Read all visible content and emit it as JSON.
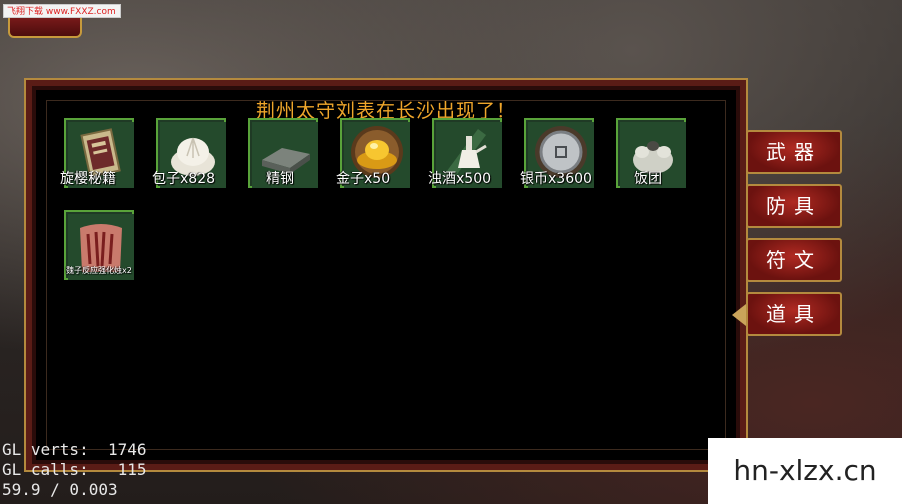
{
  "watermark_top": "飞翔下载 www.FXXZ.com",
  "panel": {
    "title": "荆州太守刘表在长沙出现了！"
  },
  "items": [
    {
      "label": "旋樱秘籍",
      "icon": "book-icon"
    },
    {
      "label": "包子x828",
      "icon": "bun-icon"
    },
    {
      "label": "精钢",
      "icon": "steel-ingot-icon"
    },
    {
      "label": "金子x50",
      "icon": "gold-ingot-icon"
    },
    {
      "label": "浊酒x500",
      "icon": "wine-jug-icon"
    },
    {
      "label": "银币x3600",
      "icon": "silver-coin-icon"
    },
    {
      "label": "饭团",
      "icon": "rice-ball-icon"
    },
    {
      "label": "魏子反应强化烛x2",
      "icon": "scroll-pouch-icon"
    }
  ],
  "tabs": [
    {
      "label": "武器",
      "active": false
    },
    {
      "label": "防具",
      "active": false
    },
    {
      "label": "符文",
      "active": false
    },
    {
      "label": "道具",
      "active": true
    }
  ],
  "debug": {
    "line1": "GL verts:  1746",
    "line2": "GL calls:   115",
    "line3": "59.9 / 0.003"
  },
  "watermark_br": "hn-xlzx.cn"
}
